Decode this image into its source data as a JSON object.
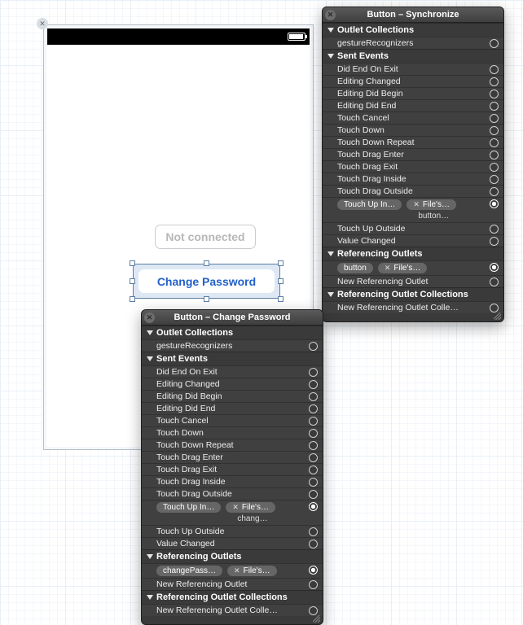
{
  "device": {
    "not_connected_label": "Not connected",
    "change_password_label": "Change Password"
  },
  "panel_sync": {
    "title": "Button – Synchronize",
    "sections": {
      "outlet_collections": {
        "header": "Outlet Collections",
        "rows": [
          "gestureRecognizers"
        ]
      },
      "sent_events": {
        "header": "Sent Events",
        "rows": [
          "Did End On Exit",
          "Editing Changed",
          "Editing Did Begin",
          "Editing Did End",
          "Touch Cancel",
          "Touch Down",
          "Touch Down Repeat",
          "Touch Drag Enter",
          "Touch Drag Exit",
          "Touch Drag Inside",
          "Touch Drag Outside"
        ],
        "connected": {
          "event": "Touch Up In…",
          "target": "File's…",
          "action": "button…"
        },
        "rows_after": [
          "Touch Up Outside",
          "Value Changed"
        ]
      },
      "referencing_outlets": {
        "header": "Referencing Outlets",
        "connected": {
          "name": "button",
          "target": "File's…"
        },
        "rows_after": [
          "New Referencing Outlet"
        ]
      },
      "referencing_outlet_collections": {
        "header": "Referencing Outlet Collections",
        "rows": [
          "New Referencing Outlet Colle…"
        ]
      }
    }
  },
  "panel_change": {
    "title": "Button – Change Password",
    "sections": {
      "outlet_collections": {
        "header": "Outlet Collections",
        "rows": [
          "gestureRecognizers"
        ]
      },
      "sent_events": {
        "header": "Sent Events",
        "rows": [
          "Did End On Exit",
          "Editing Changed",
          "Editing Did Begin",
          "Editing Did End",
          "Touch Cancel",
          "Touch Down",
          "Touch Down Repeat",
          "Touch Drag Enter",
          "Touch Drag Exit",
          "Touch Drag Inside",
          "Touch Drag Outside"
        ],
        "connected": {
          "event": "Touch Up In…",
          "target": "File's…",
          "action": "chang…"
        },
        "rows_after": [
          "Touch Up Outside",
          "Value Changed"
        ]
      },
      "referencing_outlets": {
        "header": "Referencing Outlets",
        "connected": {
          "name": "changePass…",
          "target": "File's…"
        },
        "rows_after": [
          "New Referencing Outlet"
        ]
      },
      "referencing_outlet_collections": {
        "header": "Referencing Outlet Collections",
        "rows": [
          "New Referencing Outlet Colle…"
        ]
      }
    }
  }
}
